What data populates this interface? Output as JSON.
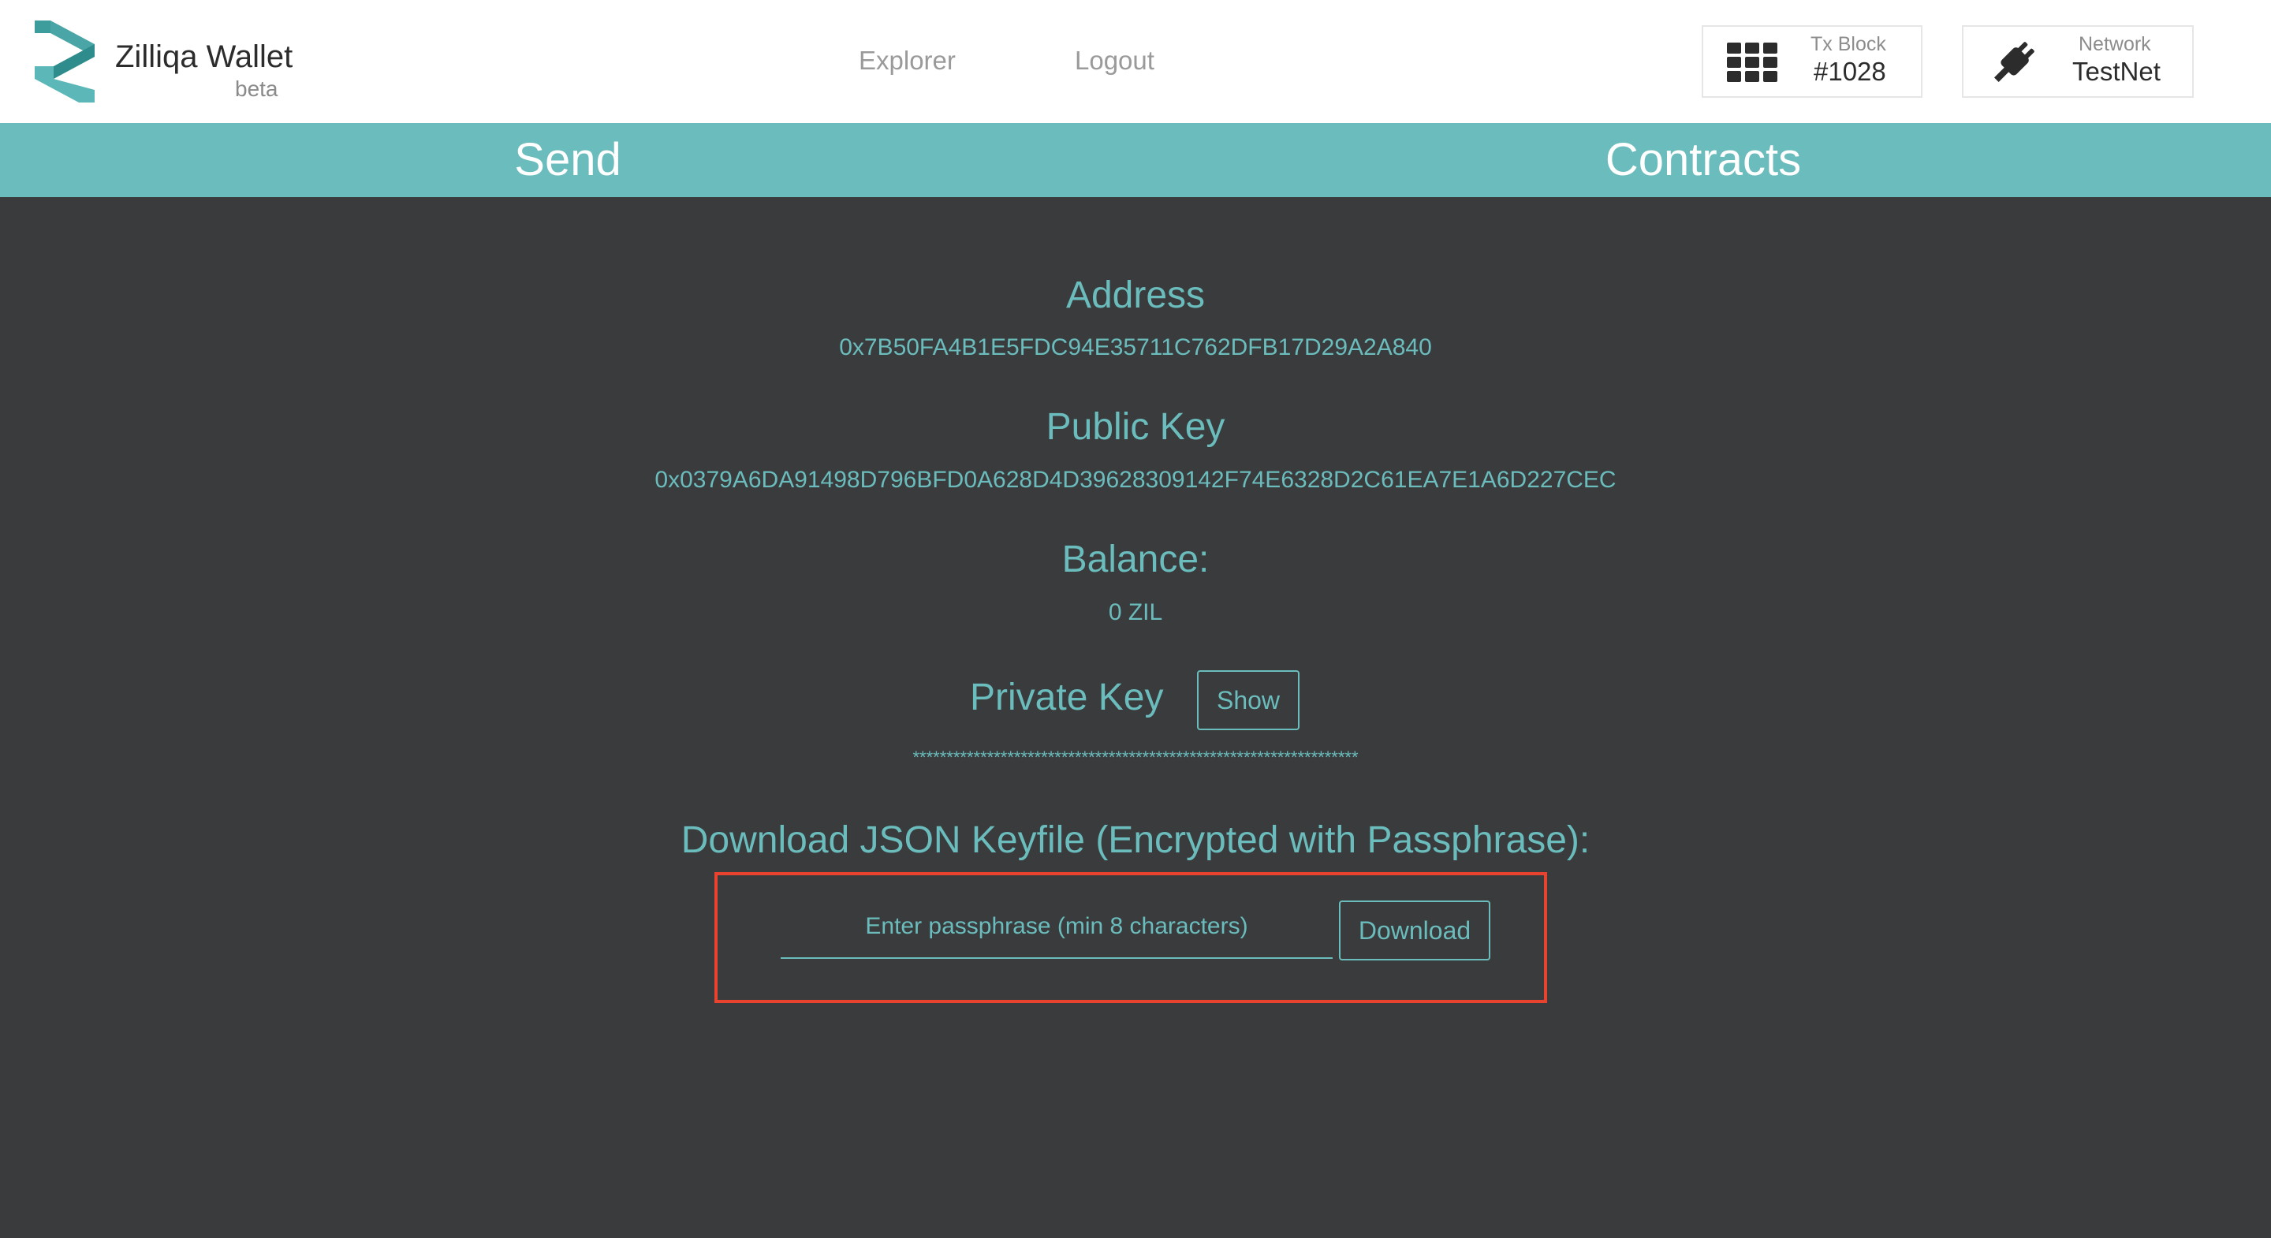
{
  "app": {
    "title": "Zilliqa Wallet",
    "subtitle": "beta",
    "logo_icon": "zilliqa-logo-icon"
  },
  "nav": {
    "explorer": "Explorer",
    "logout": "Logout"
  },
  "status": {
    "tx_block_caption": "Tx Block",
    "tx_block_value": "#1028",
    "tx_block_icon": "grid-icon",
    "network_caption": "Network",
    "network_value": "TestNet",
    "network_icon": "plug-icon"
  },
  "tabs": [
    {
      "label": "Send"
    },
    {
      "label": "Contracts"
    }
  ],
  "account": {
    "address_label": "Address",
    "address": "0x7B50FA4B1E5FDC94E35711C762DFB17D29A2A840",
    "public_key_label": "Public Key",
    "public_key": "0x0379A6DA91498D796BFD0A628D4D39628309142F74E6328D2C61EA7E1A6D227CEC",
    "balance_label": "Balance:",
    "balance": "0 ZIL",
    "private_key_label": "Private Key",
    "private_key_masked": "******************************************************************",
    "show_button": "Show"
  },
  "keyfile": {
    "heading": "Download JSON Keyfile (Encrypted with Passphrase):",
    "passphrase_placeholder": "Enter passphrase (min 8 characters)",
    "passphrase_value": "",
    "download_button": "Download"
  },
  "colors": {
    "accent": "#6bbcbc",
    "background": "#3a3b3d",
    "highlight": "#e8432e"
  }
}
